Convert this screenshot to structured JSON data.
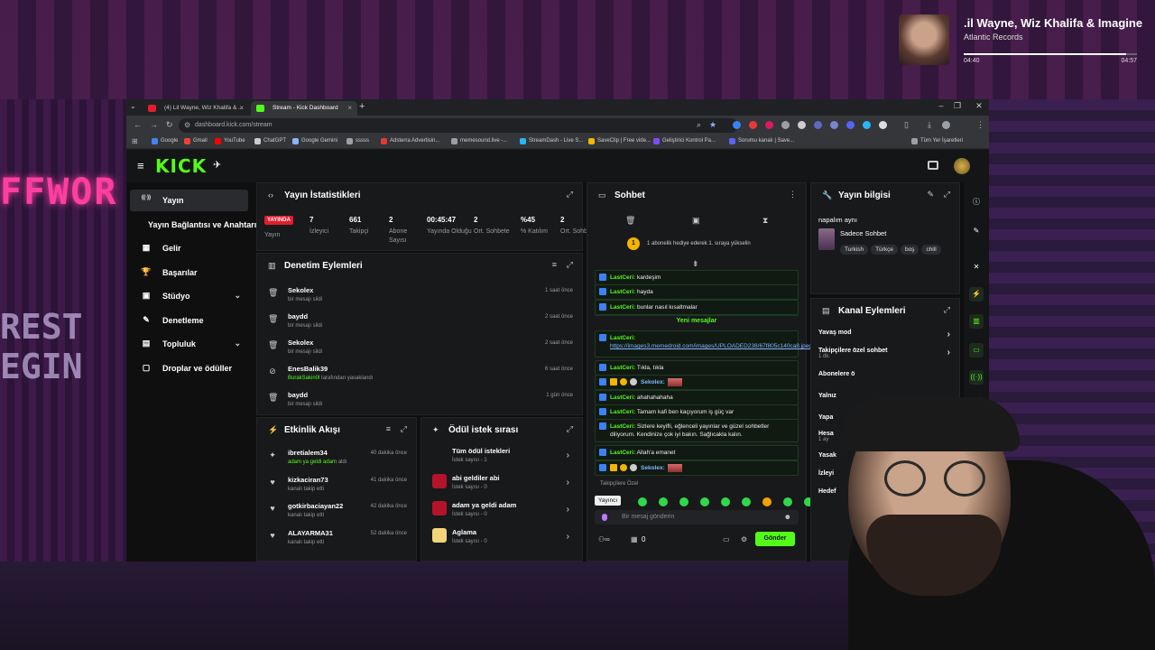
{
  "media": {
    "title": ".il Wayne, Wiz Khalifa & Imagine Dr",
    "artist": "Atlantic Records",
    "current_time": "04:40",
    "total_time": "04:57",
    "progress": 0.94
  },
  "browser": {
    "tabs": [
      {
        "label": "(4) Lil Wayne, Wiz Khalifa & ...",
        "favicon_color": "#e11d2e"
      },
      {
        "label": "Stream - Kick Dashboard",
        "favicon_color": "#53fc18"
      }
    ],
    "url": "dashboard.kick.com/stream",
    "bookmarks": [
      {
        "label": "Google",
        "color": "#4285f4"
      },
      {
        "label": "Gmail",
        "color": "#ea4335"
      },
      {
        "label": "YouTube",
        "color": "#ff0000"
      },
      {
        "label": "ChatGPT",
        "color": "#cccccc"
      },
      {
        "label": "Google Gemini",
        "color": "#8ab4f8"
      },
      {
        "label": "sssss",
        "color": "#9aa0a6"
      },
      {
        "label": "Adsterra Advertisin...",
        "color": "#e53935"
      },
      {
        "label": "memesound.live -...",
        "color": "#9aa0a6"
      },
      {
        "label": "StreamDash - Live S...",
        "color": "#29b6f6"
      },
      {
        "label": "SaveClip | Free vide...",
        "color": "#f4b400"
      },
      {
        "label": "Geliştirici Kontrol Pa...",
        "color": "#7c4dff"
      },
      {
        "label": "Sorumu kanalı | Save...",
        "color": "#5865f2"
      },
      {
        "label": "Tüm Yer İşaretleri",
        "color": "#9aa0a6"
      }
    ]
  },
  "app": {
    "logo": "KICK",
    "sidebar": [
      {
        "label": "Yayın",
        "icon": "broadcast-icon",
        "glyph": "((·))",
        "active": true
      },
      {
        "label": "Yayın Bağlantısı ve Anahtarı",
        "icon": "",
        "glyph": ""
      },
      {
        "label": "Gelir",
        "icon": "revenue-icon",
        "glyph": "▦"
      },
      {
        "label": "Başarılar",
        "icon": "trophy-icon",
        "glyph": "🏆"
      },
      {
        "label": "Stüdyo",
        "icon": "studio-icon",
        "glyph": "▣",
        "chevron": "⌄"
      },
      {
        "label": "Denetleme",
        "icon": "gavel-icon",
        "glyph": "✎"
      },
      {
        "label": "Topluluk",
        "icon": "community-icon",
        "glyph": "▤",
        "chevron": "⌄"
      },
      {
        "label": "Droplar ve ödüller",
        "icon": "gift-icon",
        "glyph": "▢"
      }
    ],
    "stats": {
      "title": "Yayın İstatistikleri",
      "live_badge": "YAYINDA",
      "live_label": "Yayın",
      "items": [
        {
          "value": "7",
          "label": "İzleyici"
        },
        {
          "value": "661",
          "label": "Takipçi"
        },
        {
          "value": "2",
          "label": "Abone Sayısı"
        },
        {
          "value": "00:45:47",
          "label": "Yayında Olduğu"
        },
        {
          "value": "2",
          "label": "Ort. Sohbete"
        },
        {
          "value": "%45",
          "label": "% Katılım"
        },
        {
          "value": "2",
          "label": "Ort. Sohbete"
        }
      ]
    },
    "moderation": {
      "title": "Denetim Eylemleri",
      "rows": [
        {
          "name": "Sekolex",
          "sub": "bir mesajı sildi",
          "time": "1 saat önce",
          "icon": "trash-icon",
          "glyph": "🗑"
        },
        {
          "name": "baydd",
          "sub": "bir mesajı sildi",
          "time": "2 saat önce",
          "icon": "trash-icon",
          "glyph": "🗑"
        },
        {
          "name": "Sekolex",
          "sub": "bir mesajı sildi",
          "time": "2 saat önce",
          "icon": "trash-icon",
          "glyph": "🗑"
        },
        {
          "name": "EnesBalik39",
          "sub_hl": "BurakSakin0l",
          "sub": " tarafından yasaklandı",
          "time": "6 saat önce",
          "icon": "ban-icon",
          "glyph": "⊘"
        },
        {
          "name": "baydd",
          "sub": "bir mesajı sildi",
          "time": "1 gün önce",
          "icon": "trash-icon",
          "glyph": "🗑"
        }
      ]
    },
    "activity": {
      "title": "Etkinlik Akışı",
      "rows": [
        {
          "name": "ibretialem34",
          "sub_hl": "adam ya geldi adam",
          "sub": " aldı",
          "time": "40 dakika önce",
          "icon": "reward-icon",
          "glyph": "✦"
        },
        {
          "name": "kizkaciran73",
          "sub": "kanalı takip etti",
          "time": "41 dakika önce",
          "icon": "heart-icon",
          "glyph": "♥"
        },
        {
          "name": "gotkirbaciayan22",
          "sub": "kanalı takip etti",
          "time": "42 dakika önce",
          "icon": "heart-icon",
          "glyph": "♥"
        },
        {
          "name": "ALAYARMA31",
          "sub": "kanalı takip etti",
          "time": "52 dakika önce",
          "icon": "heart-icon",
          "glyph": "♥"
        }
      ]
    },
    "rewards": {
      "title": "Ödül istek sırası",
      "rows": [
        {
          "name": "Tüm ödül istekleri",
          "sub": "İstek sayısı - 1",
          "color": ""
        },
        {
          "name": "abi geldiler abi",
          "sub": "İstek sayısı - 0",
          "color": "#b5132a"
        },
        {
          "name": "adam ya geldi adam",
          "sub": "İstek sayısı - 0",
          "color": "#b5132a"
        },
        {
          "name": "Aglama",
          "sub": "İstek sayısı - 0",
          "color": "#f4d37a"
        }
      ]
    },
    "chat": {
      "title": "Sohbet",
      "pinned": "1 abonelik hediye ederek 1. sıraya yükselin",
      "pinned_badge": "1",
      "messages": [
        {
          "user": "LastCeri:",
          "text": "kardeşim"
        },
        {
          "user": "LastCeri:",
          "text": "hayda"
        },
        {
          "user": "LastCeri:",
          "text": "bunlar nasıl kısaltmalar"
        },
        {
          "divider": "Yeni mesajlar"
        },
        {
          "user": "LastCeri:",
          "link": "https://images3.memedroid.com/images/UPLOADED238/67f805c140ca8.jpeg"
        },
        {
          "user": "LastCeri:",
          "text": "Tıkla, tıkla"
        },
        {
          "user": "Sekolex:",
          "text": "",
          "emote": true
        },
        {
          "user": "LastCeri:",
          "text": "ahahahahaha"
        },
        {
          "user": "LastCeri:",
          "text": "Tamam kafi ben kaçıyorum iş güç var"
        },
        {
          "user": "LastCeri:",
          "text": "Sizlere keyifli, eğlenceli yayınlar ve güzel sohbetler diliyorum. Kendinize çok iyi bakın. Sağlıcakla kalın."
        },
        {
          "user": "LastCeri:",
          "text": "Allah'a emanet"
        },
        {
          "user": "Sekolex:",
          "text": "",
          "emote": true
        }
      ],
      "followers_only": "Takipçilere Özel",
      "tooltip": "Yayıncı",
      "input_placeholder": "Bir mesaj gönderin",
      "viewer_count": "0",
      "send_label": "Gönder"
    },
    "stream_info": {
      "title": "Yayın bilgisi",
      "stream_title": "napalım aynı",
      "category": "Sadece Sohbet",
      "tags": [
        "Turkish",
        "Türkçe",
        "boş",
        "chill"
      ]
    },
    "channel_actions": {
      "title": "Kanal Eylemleri",
      "rows": [
        {
          "label": "Yavaş mod",
          "sub": ""
        },
        {
          "label": "Takipçilere özel sohbet",
          "sub": "1 dk."
        },
        {
          "label": "Abonelere ö",
          "sub": ""
        },
        {
          "label": "Yalnız",
          "sub": ""
        },
        {
          "label": "Yapa",
          "sub": ""
        },
        {
          "label": "Hesa",
          "sub": "1 ay"
        },
        {
          "label": "Yasak",
          "sub": ""
        },
        {
          "label": "İzleyi",
          "sub": ""
        },
        {
          "label": "Hedef",
          "sub": ""
        }
      ]
    }
  }
}
